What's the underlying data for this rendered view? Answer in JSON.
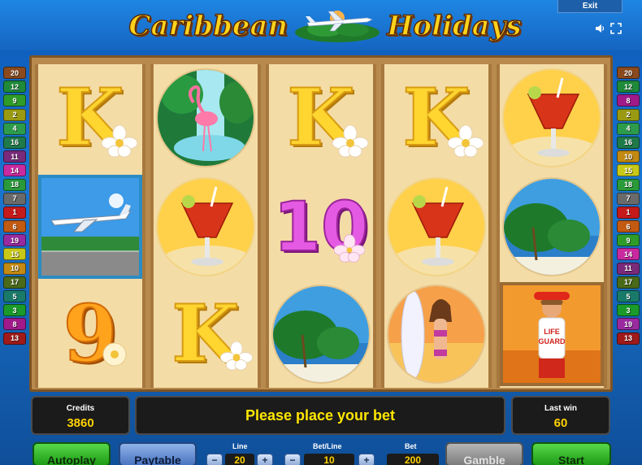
{
  "header": {
    "title_word_1": "Caribbean",
    "title_word_2": "Holidays",
    "exit_label": "Exit",
    "icons": [
      "sound-icon",
      "fullscreen-icon"
    ]
  },
  "lines_left": [
    {
      "n": "20",
      "color": "#8a4a1e"
    },
    {
      "n": "12",
      "color": "#1f8a3a"
    },
    {
      "n": "9",
      "color": "#2f9c2a"
    },
    {
      "n": "2",
      "color": "#9a9a12"
    },
    {
      "n": "4",
      "color": "#2c9c4c"
    },
    {
      "n": "16",
      "color": "#1f7a4a"
    },
    {
      "n": "11",
      "color": "#7a2a7a"
    },
    {
      "n": "14",
      "color": "#c92aa0"
    },
    {
      "n": "18",
      "color": "#2a9a3a"
    },
    {
      "n": "7",
      "color": "#6a6a6a"
    },
    {
      "n": "1",
      "color": "#c41a1a"
    },
    {
      "n": "6",
      "color": "#c25a12"
    },
    {
      "n": "19",
      "color": "#9a2aa0"
    },
    {
      "n": "15",
      "color": "#c8c818"
    },
    {
      "n": "10",
      "color": "#c28a12"
    },
    {
      "n": "17",
      "color": "#4a6a1a"
    },
    {
      "n": "5",
      "color": "#1a7a6a"
    },
    {
      "n": "3",
      "color": "#1a9a2a"
    },
    {
      "n": "8",
      "color": "#a01a8a"
    },
    {
      "n": "13",
      "color": "#a01a1a"
    }
  ],
  "lines_right": [
    {
      "n": "20",
      "color": "#8a4a1e"
    },
    {
      "n": "12",
      "color": "#1f8a3a"
    },
    {
      "n": "8",
      "color": "#a01a8a"
    },
    {
      "n": "2",
      "color": "#9a9a12"
    },
    {
      "n": "4",
      "color": "#2c9c4c"
    },
    {
      "n": "16",
      "color": "#1f7a4a"
    },
    {
      "n": "10",
      "color": "#c28a12"
    },
    {
      "n": "15",
      "color": "#c8c818"
    },
    {
      "n": "18",
      "color": "#2a9a3a"
    },
    {
      "n": "7",
      "color": "#6a6a6a"
    },
    {
      "n": "1",
      "color": "#c41a1a"
    },
    {
      "n": "6",
      "color": "#c25a12"
    },
    {
      "n": "9",
      "color": "#2f9c2a"
    },
    {
      "n": "14",
      "color": "#c92aa0"
    },
    {
      "n": "11",
      "color": "#7a2a7a"
    },
    {
      "n": "17",
      "color": "#4a6a1a"
    },
    {
      "n": "5",
      "color": "#1a7a6a"
    },
    {
      "n": "3",
      "color": "#1a9a2a"
    },
    {
      "n": "19",
      "color": "#9a2aa0"
    },
    {
      "n": "13",
      "color": "#a01a1a"
    }
  ],
  "reels": [
    [
      "K",
      "airplane",
      "9"
    ],
    [
      "flamingo",
      "cocktail",
      "K"
    ],
    [
      "K",
      "10",
      "palm-beach"
    ],
    [
      "K",
      "cocktail",
      "surfer-girl"
    ],
    [
      "cocktail",
      "palm-beach",
      "lifeguard"
    ]
  ],
  "panel": {
    "credits_label": "Credits",
    "credits_value": "3860",
    "message": "Please place your bet",
    "last_win_label": "Last win",
    "last_win_value": "60",
    "autoplay_label": "Autoplay",
    "paytable_label": "Paytable",
    "line_label": "Line",
    "line_value": "20",
    "bet_line_label": "Bet/Line",
    "bet_line_value": "10",
    "bet_label": "Bet",
    "bet_value": "200",
    "minus": "−",
    "plus": "+",
    "gamble_label": "Gamble",
    "start_label": "Start"
  }
}
